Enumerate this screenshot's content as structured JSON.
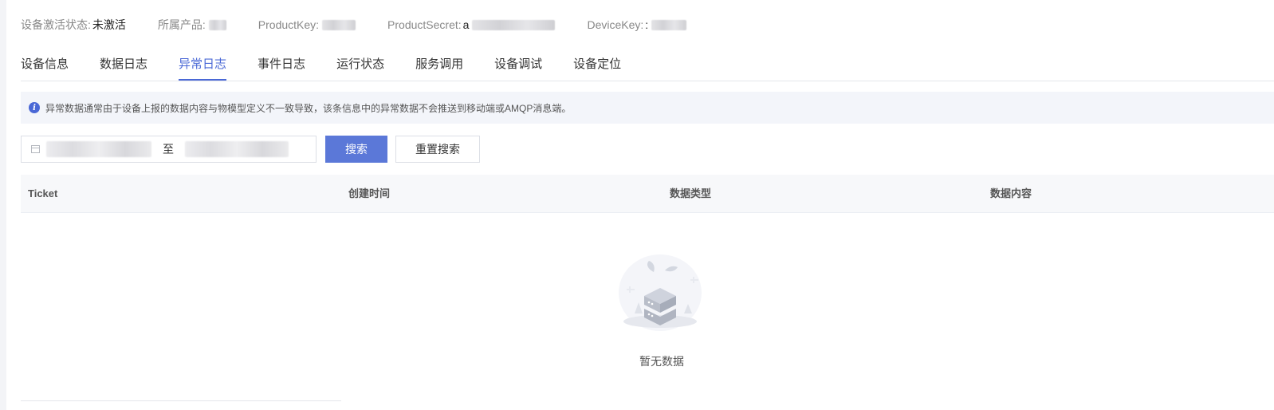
{
  "info_bar": {
    "activation_label": "设备激活状态:",
    "activation_value": "未激活",
    "product_label": "所属产品:",
    "product_key_label": "ProductKey:",
    "product_secret_label": "ProductSecret:",
    "product_secret_prefix": "a",
    "device_key_label": "DeviceKey:",
    "device_key_prefix": ":"
  },
  "tabs": [
    {
      "label": "设备信息",
      "active": false
    },
    {
      "label": "数据日志",
      "active": false
    },
    {
      "label": "异常日志",
      "active": true
    },
    {
      "label": "事件日志",
      "active": false
    },
    {
      "label": "运行状态",
      "active": false
    },
    {
      "label": "服务调用",
      "active": false
    },
    {
      "label": "设备调试",
      "active": false
    },
    {
      "label": "设备定位",
      "active": false
    }
  ],
  "notice": {
    "icon": "info-icon",
    "text": "异常数据通常由于设备上报的数据内容与物模型定义不一致导致，该条信息中的异常数据不会推送到移动端或AMQP消息端。"
  },
  "filter": {
    "range_separator": "至",
    "search_label": "搜索",
    "reset_label": "重置搜索"
  },
  "table": {
    "columns": [
      "Ticket",
      "创建时间",
      "数据类型",
      "数据内容"
    ]
  },
  "empty_state": {
    "text": "暂无数据"
  },
  "colors": {
    "accent": "#4a68d6",
    "button": "#5b78d8"
  }
}
